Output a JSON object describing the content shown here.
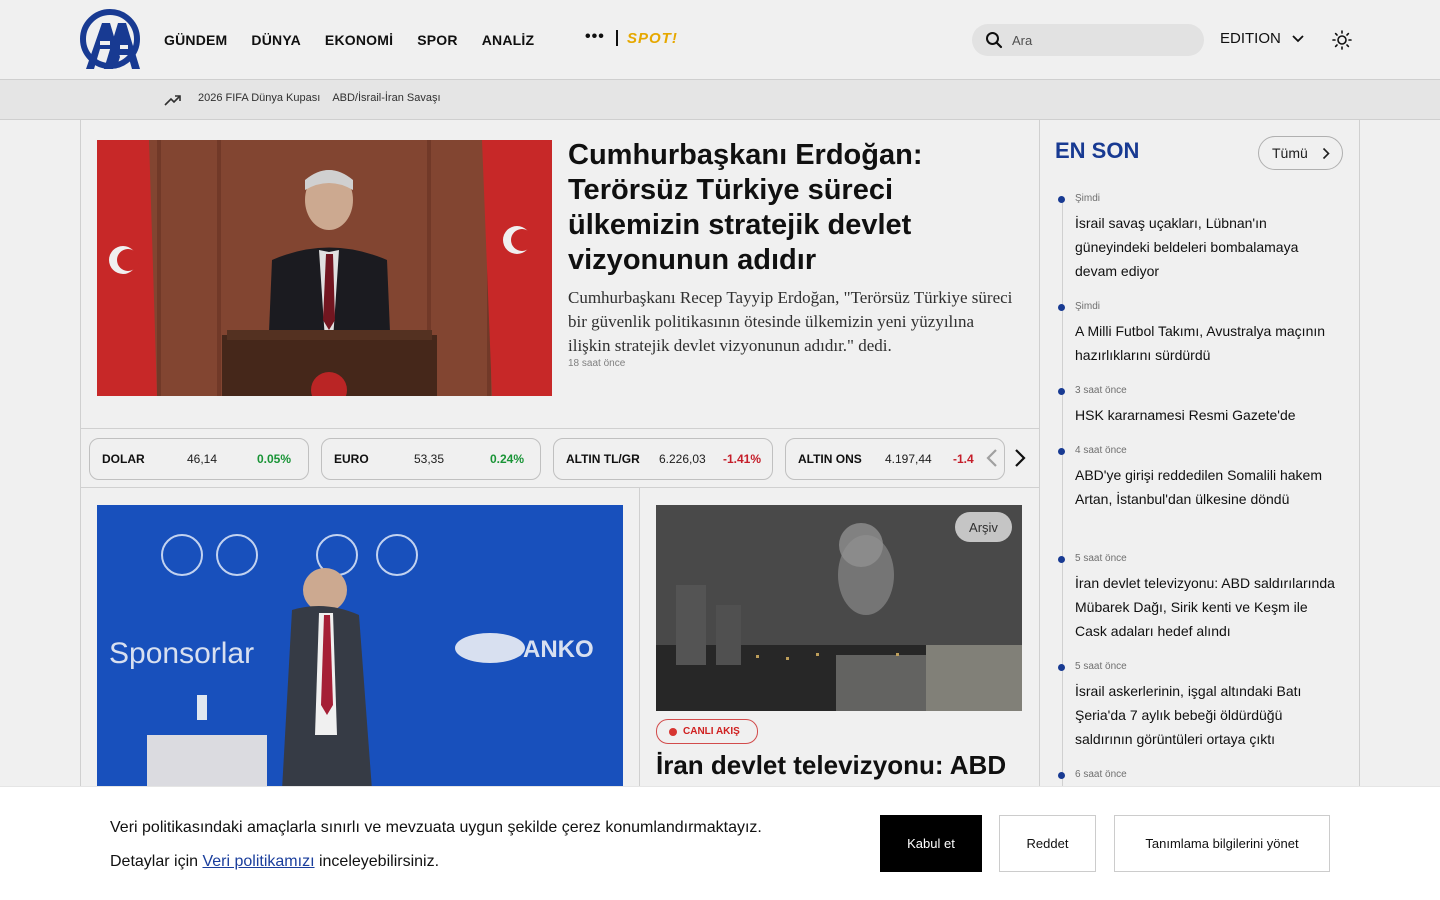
{
  "brand": {
    "logo_text": "AA",
    "accent_color": "#1a3e9c"
  },
  "nav": {
    "items": [
      "GÜNDEM",
      "DÜNYA",
      "EKONOMİ",
      "SPOR",
      "ANALİZ"
    ],
    "more_label": "•••",
    "spot_label": "SPOT!"
  },
  "search": {
    "placeholder": "Ara"
  },
  "edition_label": "EDITION",
  "trending": {
    "links": [
      "2026 FIFA Dünya Kupası",
      "ABD/İsrail-İran Savaşı"
    ]
  },
  "hero": {
    "title": "Cumhurbaşkanı Erdoğan: Terörsüz Türkiye süreci ülkemizin stratejik devlet vizyonunun adıdır",
    "summary": "Cumhurbaşkanı Recep Tayyip Erdoğan, \"Terörsüz Türkiye süreci bir güvenlik politikasının ötesinde ülkemizin yeni yüzyılına ilişkin stratejik devlet vizyonunun adıdır.\" dedi.",
    "time": "18 saat önce"
  },
  "tickers": [
    {
      "name": "DOLAR",
      "value": "46,14",
      "change": "0.05%",
      "dir": "up"
    },
    {
      "name": "EURO",
      "value": "53,35",
      "change": "0.24%",
      "dir": "up"
    },
    {
      "name": "ALTIN TL/GR",
      "value": "6.226,03",
      "change": "-1.41%",
      "dir": "down"
    },
    {
      "name": "ALTIN ONS",
      "value": "4.197,44",
      "change": "-1.4",
      "dir": "down"
    }
  ],
  "card1": {
    "sponsor_text": "Sponsorlar",
    "sponsor_brand": "SANKO"
  },
  "card2": {
    "badge": "Arşiv",
    "live_label": "CANLI AKIŞ",
    "title": "İran devlet televizyonu: ABD"
  },
  "sidebar": {
    "title": "EN SON",
    "all_label": "Tümü",
    "items": [
      {
        "time": "Şimdi",
        "headline": "İsrail savaş uçakları, Lübnan'ın güneyindeki beldeleri bombalamaya devam ediyor"
      },
      {
        "time": "Şimdi",
        "headline": "A Milli Futbol Takımı, Avustralya maçının hazırlıklarını sürdürdü"
      },
      {
        "time": "3 saat önce",
        "headline": "HSK kararnamesi Resmi Gazete'de"
      },
      {
        "time": "4 saat önce",
        "headline": "ABD'ye girişi reddedilen Somalili hakem Artan, İstanbul'dan ülkesine döndü"
      },
      {
        "time": "5 saat önce",
        "headline": "İran devlet televizyonu: ABD saldırılarında Mübarek Dağı, Sirik kenti ve Keşm ile Cask adaları hedef alındı"
      },
      {
        "time": "5 saat önce",
        "headline": "İsrail askerlerinin, işgal altındaki Batı Şeria'da 7 aylık bebeği öldürdüğü saldırının görüntüleri ortaya çıktı"
      },
      {
        "time": "6 saat önce",
        "headline": ""
      }
    ]
  },
  "cookie": {
    "line1": "Veri politikasındaki amaçlarla sınırlı ve mevzuata uygun şekilde çerez konumlandırmaktayız.",
    "line2_prefix": "Detaylar için ",
    "link_label": "Veri politikamızı",
    "line2_suffix": " inceleyebilirsiniz.",
    "accept": "Kabul et",
    "reject": "Reddet",
    "manage": "Tanımlama bilgilerini yönet"
  }
}
